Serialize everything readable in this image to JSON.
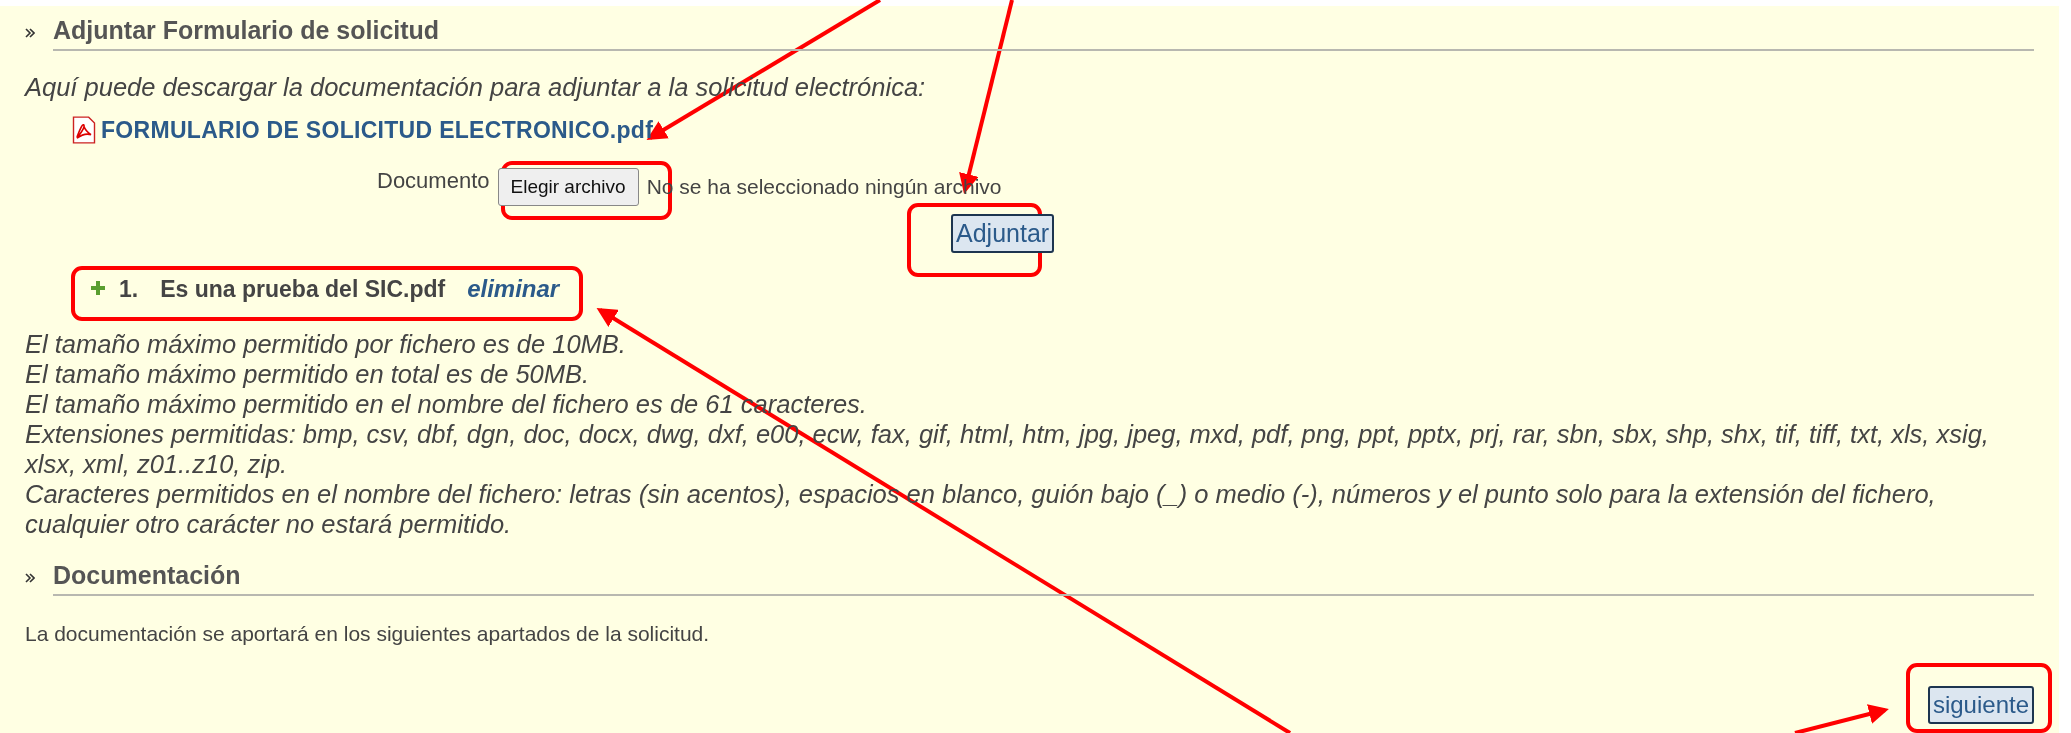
{
  "upload_section": {
    "title": "Adjuntar Formulario de solicitud",
    "intro": "Aquí puede descargar la documentación para adjuntar a la solicitud electrónica:",
    "download_link": "FORMULARIO DE SOLICITUD ELECTRONICO.pdf",
    "file_input": {
      "label": "Documento",
      "button": "Elegir archivo",
      "status": "No se ha seleccionado ningún archivo"
    },
    "attach_button": "Adjuntar",
    "attachments": [
      {
        "number": "1.",
        "name": "Es una prueba del SIC.pdf",
        "action": "eliminar"
      }
    ],
    "notes": [
      "El tamaño máximo permitido por fichero es de 10MB.",
      "El tamaño máximo permitido en total es de 50MB.",
      "El tamaño máximo permitido en el nombre del fichero es de 61 caracteres.",
      "Extensiones permitidas: bmp, csv, dbf, dgn, doc, docx, dwg, dxf, e00, ecw, fax, gif, html, htm, jpg, jpeg, mxd, pdf, png, ppt, pptx, prj, rar, sbn, sbx, shp, shx, tif, tiff, txt, xls, xsig, xlsx, xml, z01..z10, zip.",
      "Caracteres permitidos en el nombre del fichero: letras (sin acentos), espacios en blanco, guión bajo (_) o medio (-), números y el punto solo para la extensión del fichero, cualquier otro carácter no estará permitido."
    ]
  },
  "documentation_section": {
    "title": "Documentación",
    "text": "La documentación se aportará en los siguientes apartados de la solicitud."
  },
  "next_button": "siguiente"
}
